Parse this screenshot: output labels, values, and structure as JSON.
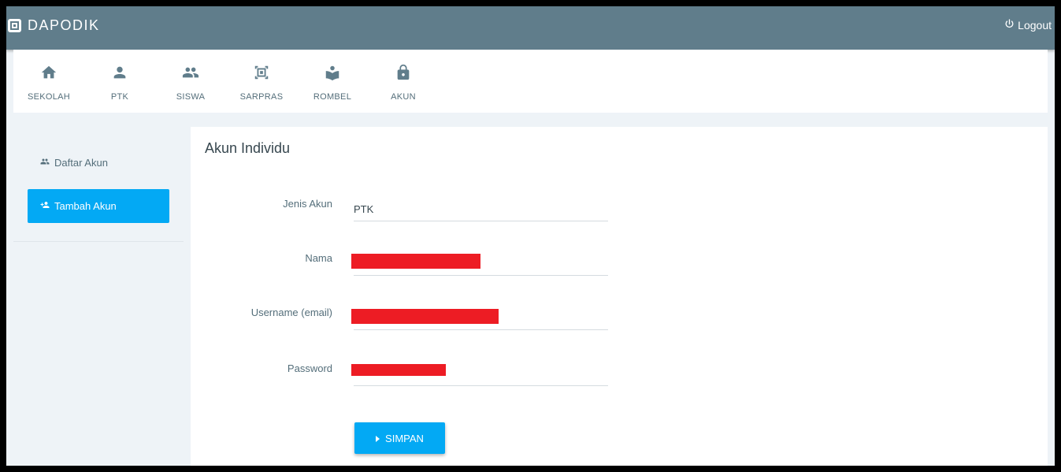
{
  "app": {
    "name": "DAPODIK"
  },
  "header": {
    "logout_label": "Logout"
  },
  "modules": [
    {
      "label": "SEKOLAH",
      "icon": "home-icon"
    },
    {
      "label": "PTK",
      "icon": "person-icon"
    },
    {
      "label": "SISWA",
      "icon": "people-icon"
    },
    {
      "label": "SARPRAS",
      "icon": "building-frame-icon"
    },
    {
      "label": "ROMBEL",
      "icon": "book-reader-icon"
    },
    {
      "label": "AKUN",
      "icon": "lock-icon"
    }
  ],
  "sidebar": {
    "items": [
      {
        "label": "Daftar Akun",
        "icon": "users-icon",
        "active": false
      },
      {
        "label": "Tambah Akun",
        "icon": "add-user-icon",
        "active": true
      }
    ]
  },
  "form": {
    "title": "Akun Individu",
    "fields": [
      {
        "label": "Jenis Akun",
        "value": "PTK"
      },
      {
        "label": "Nama",
        "value": ""
      },
      {
        "label": "Username (email)",
        "value": ""
      },
      {
        "label": "Password",
        "value": ""
      }
    ],
    "submit_label": "SIMPAN"
  },
  "colors": {
    "topbar": "#607d8b",
    "accent": "#03a9f4",
    "redaction": "#ed1c24",
    "background": "#eef3f7"
  }
}
